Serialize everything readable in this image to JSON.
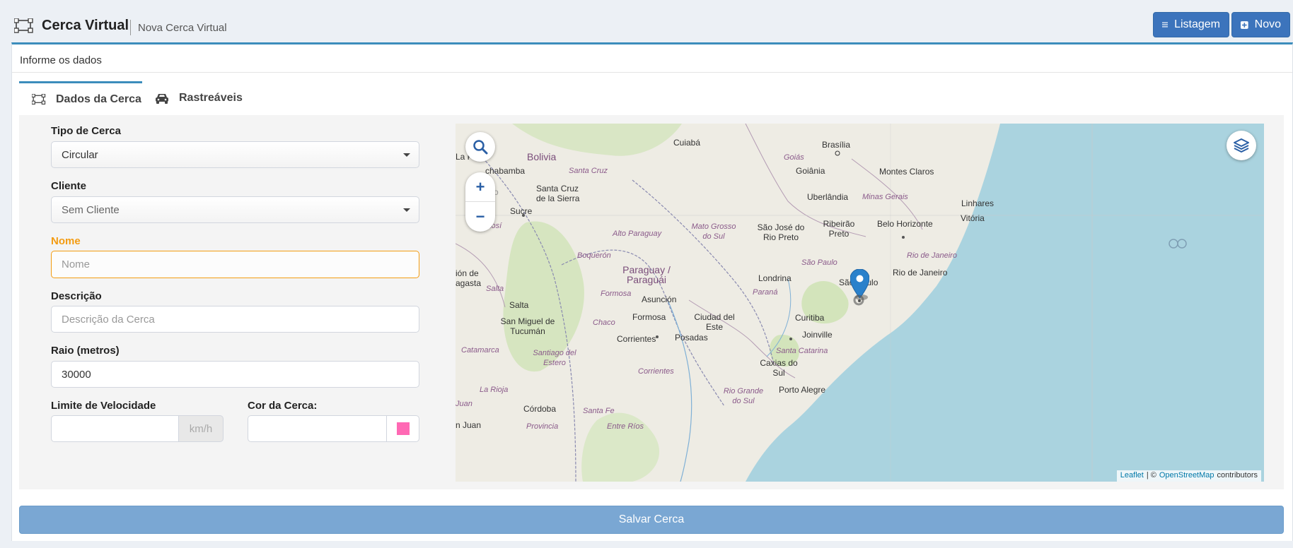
{
  "header": {
    "title": "Cerca Virtual",
    "subtitle": "Nova Cerca Virtual",
    "btn_listagem": "Listagem",
    "btn_novo": "Novo"
  },
  "box": {
    "header": "Informe os dados"
  },
  "tabs": [
    {
      "label": "Dados da Cerca"
    },
    {
      "label": "Rastreáveis"
    }
  ],
  "form": {
    "tipo_label": "Tipo de Cerca",
    "tipo_value": "Circular",
    "cliente_label": "Cliente",
    "cliente_value": "Sem Cliente",
    "nome_label": "Nome",
    "nome_placeholder": "Nome",
    "descricao_label": "Descrição",
    "descricao_placeholder": "Descrição da Cerca",
    "raio_label": "Raio (metros)",
    "raio_value": "30000",
    "velocidade_label": "Limite de Velocidade",
    "velocidade_unit": "km/h",
    "cor_label": "Cor da Cerca:",
    "cor_value": "#ff69b4"
  },
  "map": {
    "zoom_in": "+",
    "zoom_out": "−",
    "attrib_leaflet": "Leaflet",
    "attrib_sep": "| ©",
    "attrib_osm": "OpenStreetMap",
    "attrib_contrib": "contributors",
    "labels": {
      "bolivia": "Bolivia",
      "cuiaba": "Cuiabá",
      "brasilia": "Brasília",
      "goias": "Goiás",
      "goiania": "Goiânia",
      "montes_claros": "Montes Claros",
      "la_paz": "La Paz",
      "cochabamba": "chabamba",
      "santa_cruz_r": "Santa Cruz",
      "santa_cruz": "Santa Cruz de la Sierra",
      "uberlandia": "Uberlândia",
      "minas": "Minas Gerais",
      "oruro": "Oruro",
      "sucre": "Sucre",
      "linhares": "Linhares",
      "vitoria": "Vitória",
      "potosi": "Potosí",
      "alto_paraguay": "Alto Paraguay",
      "mato_grosso": "Mato Grosso do Sul",
      "sao_jose": "São José do Rio Preto",
      "ribeirao": "Ribeirão Preto",
      "belo_horizonte": "Belo Horizonte",
      "boqueron": "Boquerón",
      "paraguay": "Paraguay / Paraguái",
      "sao_paulo_r": "São Paulo",
      "rio_r": "Rio de Janeiro",
      "rio": "Rio de Janeiro",
      "sao_paulo": "São Paulo",
      "londrina": "Londrina",
      "uion": "ión de agasta",
      "salta_r": "Salta",
      "formosa_r": "Formosa",
      "asuncion": "Asunción",
      "parana": "Paraná",
      "salta": "Salta",
      "san_miguel": "San Miguel de Tucumán",
      "chaco": "Chaco",
      "formosa": "Formosa",
      "ciudad_este": "Ciudad del Este",
      "curitiba": "Curitiba",
      "joinville": "Joinville",
      "corrientes": "Corrientes",
      "posadas": "Posadas",
      "catamarca": "Catamarca",
      "santiago": "Santiago del Estero",
      "santa_catarina": "Santa Catarina",
      "caxias": "Caxias do Sul",
      "corrientes_r": "Corrientes",
      "la_rioja": "La Rioja",
      "rio_grande": "Rio Grande do Sul",
      "porto_alegre": "Porto Alegre",
      "juan": "Juan",
      "cordoba": "Córdoba",
      "santa_fe": "Santa Fe",
      "n_juan": "n Juan",
      "provincia": "Provincia",
      "entre_rios": "Entre Ríos"
    }
  },
  "save_label": "Salvar Cerca"
}
